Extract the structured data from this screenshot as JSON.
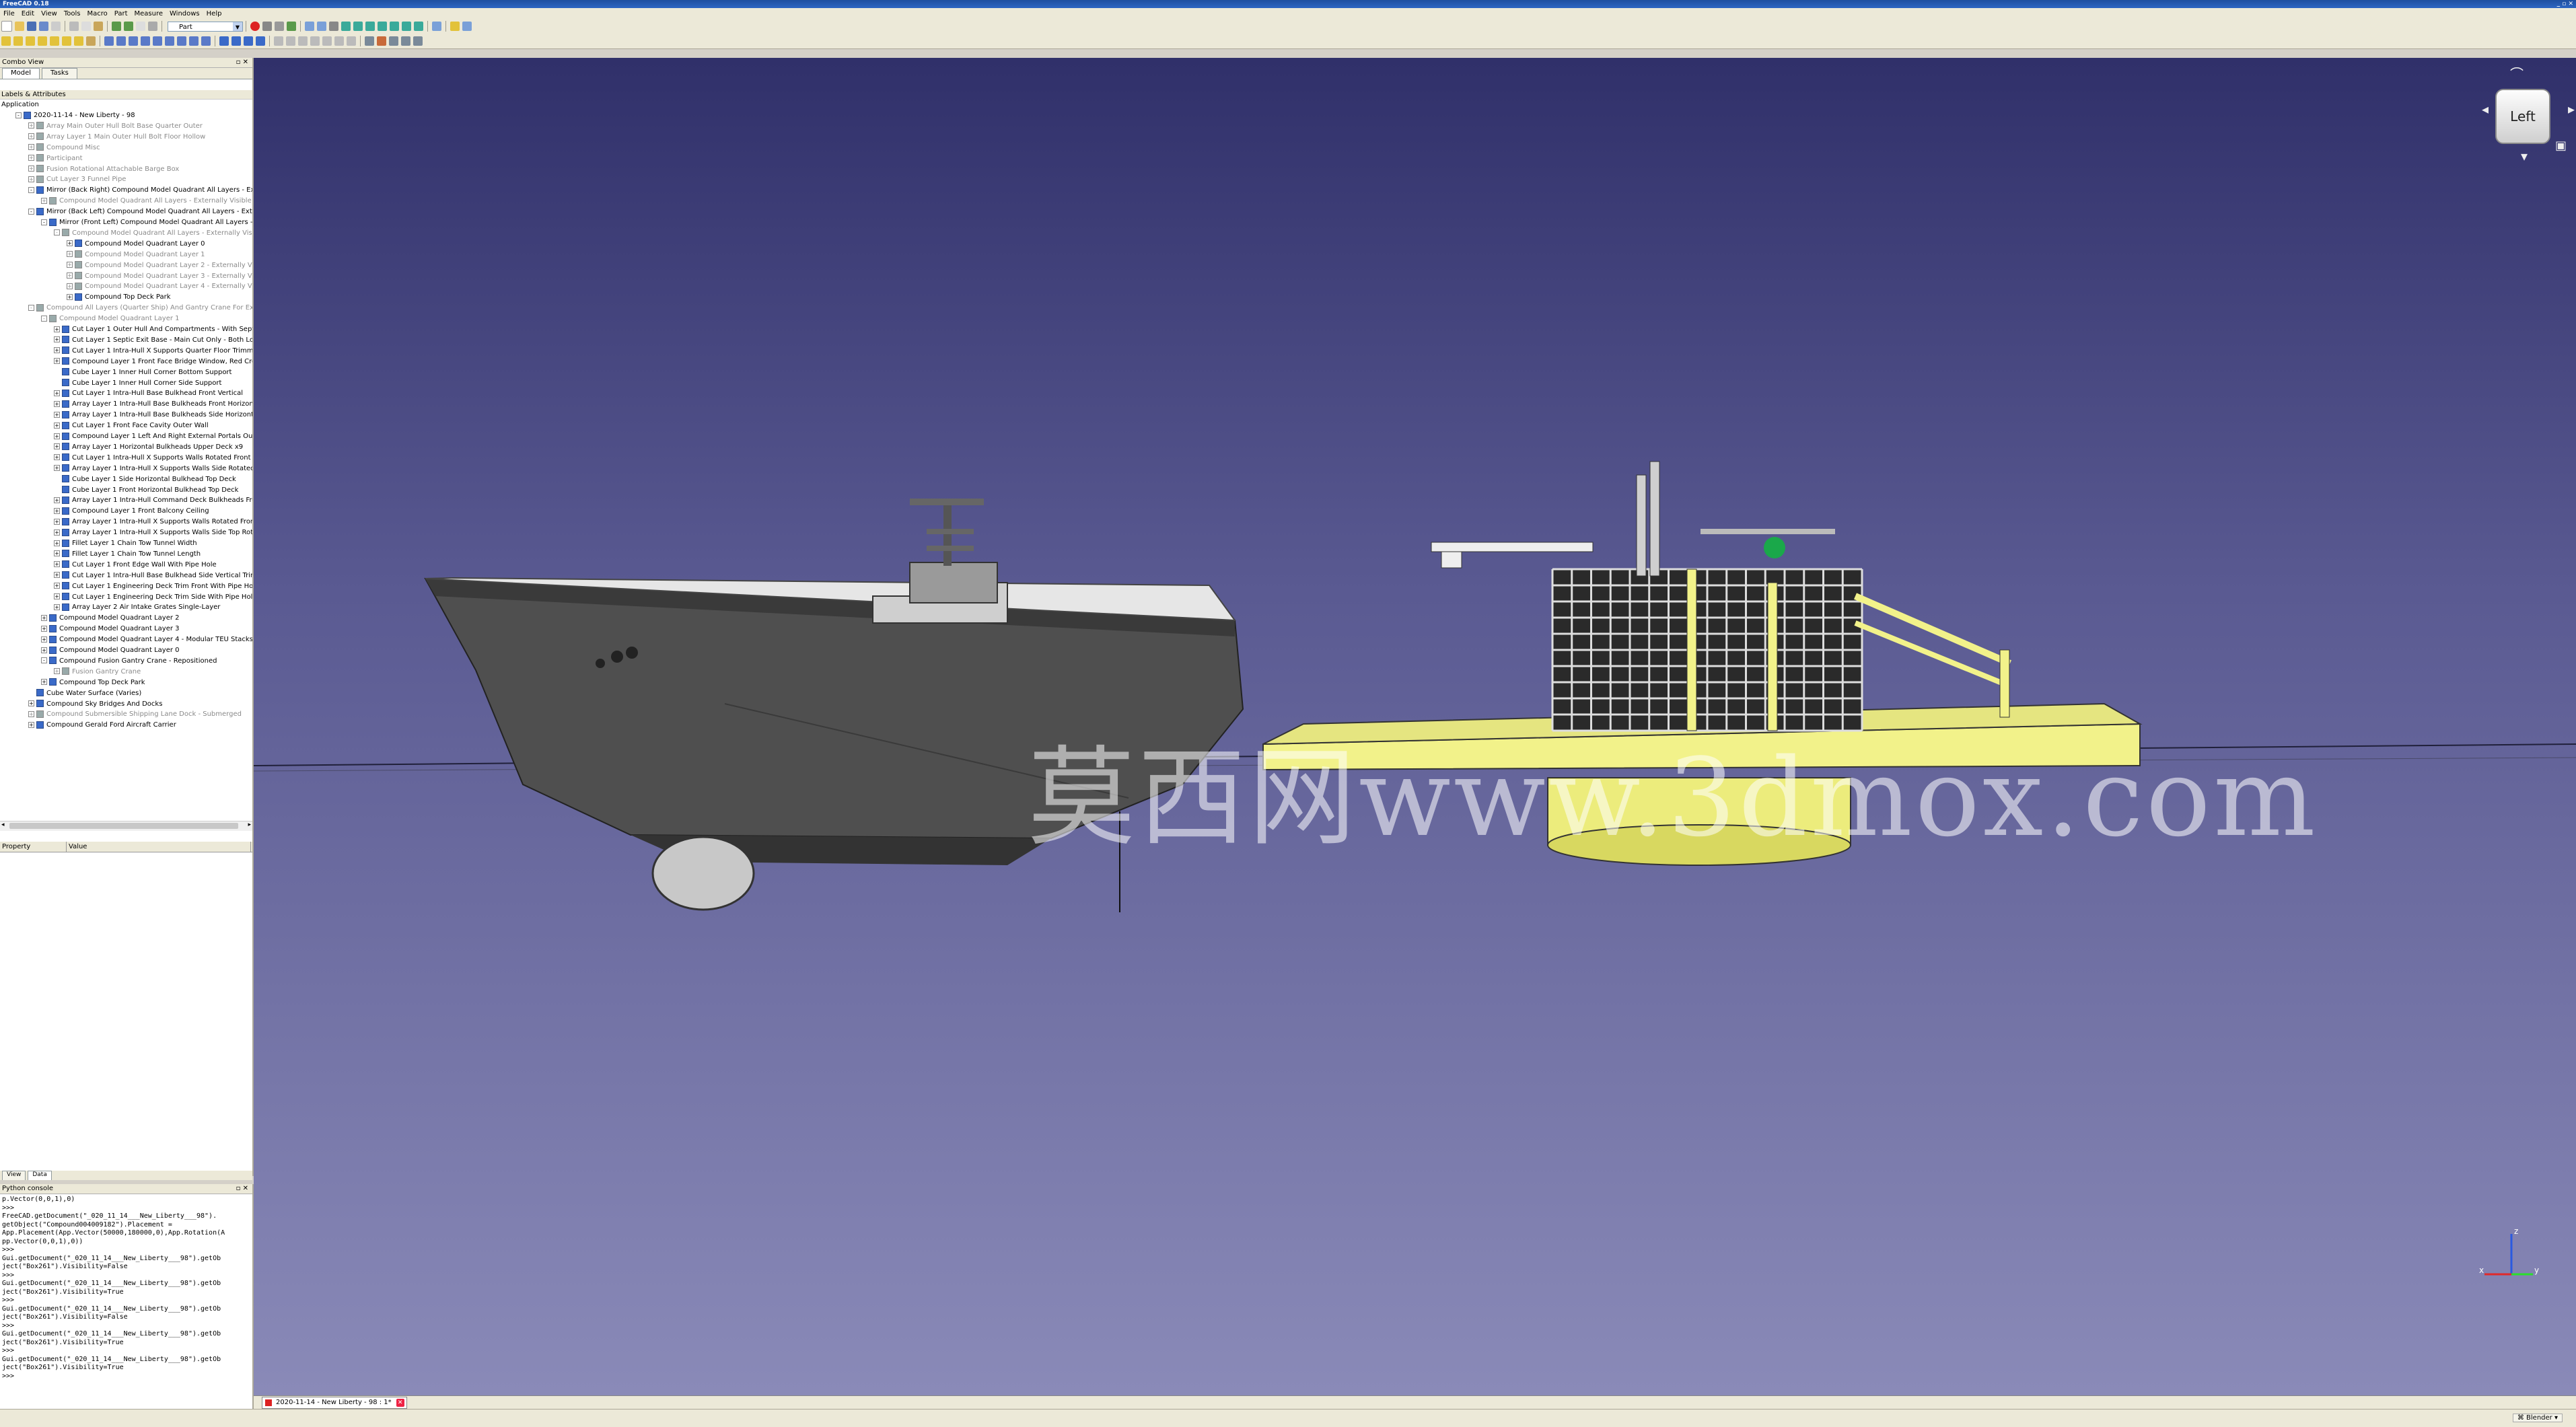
{
  "window": {
    "title": "FreeCAD 0.18",
    "controls": "_ ▫ ✕"
  },
  "menu": [
    "File",
    "Edit",
    "View",
    "Tools",
    "Macro",
    "Part",
    "Measure",
    "Windows",
    "Help"
  ],
  "toolbar": {
    "workbench": "Part"
  },
  "combo": {
    "title": "Combo View",
    "tabs": [
      "Model",
      "Tasks"
    ],
    "labels_header": "Labels & Attributes",
    "application": "Application",
    "tree": [
      {
        "text": "2020-11-14 - New Liberty - 98",
        "indent": 1,
        "grey": false,
        "exp": "-"
      },
      {
        "text": "Array Main Outer Hull Bolt Base Quarter Outer",
        "indent": 2,
        "grey": true,
        "exp": "+"
      },
      {
        "text": "Array Layer 1 Main Outer Hull Bolt Floor Hollow",
        "indent": 2,
        "grey": true,
        "exp": "+"
      },
      {
        "text": "Compound Misc",
        "indent": 2,
        "grey": true,
        "exp": "+"
      },
      {
        "text": "Participant",
        "indent": 2,
        "grey": true,
        "exp": "+"
      },
      {
        "text": "Fusion Rotational Attachable Barge Box",
        "indent": 2,
        "grey": true,
        "exp": "+"
      },
      {
        "text": "Cut Layer 3 Funnel Pipe",
        "indent": 2,
        "grey": true,
        "exp": "+"
      },
      {
        "text": "Mirror (Back Right) Compound Model Quadrant All Layers - Exter",
        "indent": 2,
        "grey": false,
        "exp": "-"
      },
      {
        "text": "Compound Model Quadrant All Layers - Externally Visible On",
        "indent": 3,
        "grey": true,
        "exp": "+"
      },
      {
        "text": "Mirror (Back Left) Compound Model Quadrant All Layers - Extern",
        "indent": 2,
        "grey": false,
        "exp": "-"
      },
      {
        "text": "Mirror (Front Left) Compound Model Quadrant All Layers - E",
        "indent": 3,
        "grey": false,
        "exp": "-"
      },
      {
        "text": "Compound Model Quadrant All Layers - Externally Visible",
        "indent": 4,
        "grey": true,
        "exp": "-"
      },
      {
        "text": "Compound Model Quadrant Layer 0",
        "indent": 5,
        "grey": false,
        "exp": "+"
      },
      {
        "text": "Compound Model Quadrant Layer 1",
        "indent": 5,
        "grey": true,
        "exp": "+"
      },
      {
        "text": "Compound Model Quadrant Layer 2 - Externally Vis",
        "indent": 5,
        "grey": true,
        "exp": "+"
      },
      {
        "text": "Compound Model Quadrant Layer 3 - Externally Vis",
        "indent": 5,
        "grey": true,
        "exp": "+"
      },
      {
        "text": "Compound Model Quadrant Layer 4 - Externally Vis",
        "indent": 5,
        "grey": true,
        "exp": "+"
      },
      {
        "text": "Compound Top Deck Park",
        "indent": 5,
        "grey": false,
        "exp": "+"
      },
      {
        "text": "Compound All Layers (Quarter Ship) And Gantry Crane For Expo",
        "indent": 2,
        "grey": true,
        "exp": "-"
      },
      {
        "text": "Compound Model Quadrant Layer 1",
        "indent": 3,
        "grey": true,
        "exp": "-"
      },
      {
        "text": "Cut Layer 1 Outer Hull And Compartments - With Septic",
        "indent": 4,
        "grey": false,
        "exp": "+"
      },
      {
        "text": "Cut Layer 1 Septic Exit Base - Main Cut Only - Both Loca",
        "indent": 4,
        "grey": false,
        "exp": "+"
      },
      {
        "text": "Cut Layer 1 Intra-Hull X Supports Quarter Floor Trimmed",
        "indent": 4,
        "grey": false,
        "exp": "+"
      },
      {
        "text": "Compound Layer 1 Front Face Bridge Window, Red Cros",
        "indent": 4,
        "grey": false,
        "exp": "+"
      },
      {
        "text": "Cube Layer 1 Inner Hull Corner Bottom Support",
        "indent": 4,
        "grey": false,
        "exp": ""
      },
      {
        "text": "Cube Layer 1 Inner Hull Corner Side Support",
        "indent": 4,
        "grey": false,
        "exp": ""
      },
      {
        "text": "Cut Layer 1 Intra-Hull Base Bulkhead Front Vertical",
        "indent": 4,
        "grey": false,
        "exp": "+"
      },
      {
        "text": "Array Layer 1 Intra-Hull Base Bulkheads Front Horizonta",
        "indent": 4,
        "grey": false,
        "exp": "+"
      },
      {
        "text": "Array Layer 1 Intra-Hull Base Bulkheads Side Horizontal",
        "indent": 4,
        "grey": false,
        "exp": "+"
      },
      {
        "text": "Cut Layer 1 Front Face Cavity Outer Wall",
        "indent": 4,
        "grey": false,
        "exp": "+"
      },
      {
        "text": "Compound Layer 1 Left And Right External Portals Oute",
        "indent": 4,
        "grey": false,
        "exp": "+"
      },
      {
        "text": "Array Layer 1 Horizontal Bulkheads Upper Deck x9",
        "indent": 4,
        "grey": false,
        "exp": "+"
      },
      {
        "text": "Cut Layer 1 Intra-Hull X Supports Walls Rotated Front T",
        "indent": 4,
        "grey": false,
        "exp": "+"
      },
      {
        "text": "Array Layer 1 Intra-Hull X Supports Walls Side Rotated I",
        "indent": 4,
        "grey": false,
        "exp": "+"
      },
      {
        "text": "Cube Layer 1 Side Horizontal Bulkhead Top Deck",
        "indent": 4,
        "grey": false,
        "exp": ""
      },
      {
        "text": "Cube Layer 1 Front Horizontal Bulkhead Top Deck",
        "indent": 4,
        "grey": false,
        "exp": ""
      },
      {
        "text": "Array Layer 1 Intra-Hull Command Deck Bulkheads Fron",
        "indent": 4,
        "grey": false,
        "exp": "+"
      },
      {
        "text": "Compound Layer 1 Front Balcony Ceiling",
        "indent": 4,
        "grey": false,
        "exp": "+"
      },
      {
        "text": "Array Layer 1 Intra-Hull X Supports Walls Rotated Front",
        "indent": 4,
        "grey": false,
        "exp": "+"
      },
      {
        "text": "Array Layer 1 Intra-Hull X Supports Walls Side Top Rota",
        "indent": 4,
        "grey": false,
        "exp": "+"
      },
      {
        "text": "Fillet Layer 1 Chain Tow Tunnel Width",
        "indent": 4,
        "grey": false,
        "exp": "+"
      },
      {
        "text": "Fillet Layer 1 Chain Tow Tunnel Length",
        "indent": 4,
        "grey": false,
        "exp": "+"
      },
      {
        "text": "Cut Layer 1 Front Edge Wall With Pipe Hole",
        "indent": 4,
        "grey": false,
        "exp": "+"
      },
      {
        "text": "Cut Layer 1 Intra-Hull Base Bulkhead Side Vertical Trimm",
        "indent": 4,
        "grey": false,
        "exp": "+"
      },
      {
        "text": "Cut Layer 1 Engineering Deck Trim Front With Pipe Hole",
        "indent": 4,
        "grey": false,
        "exp": "+"
      },
      {
        "text": "Cut Layer 1 Engineering Deck Trim Side With Pipe Hole",
        "indent": 4,
        "grey": false,
        "exp": "+"
      },
      {
        "text": "Array Layer 2 Air Intake Grates Single-Layer",
        "indent": 4,
        "grey": false,
        "exp": "+"
      },
      {
        "text": "Compound Model Quadrant Layer 2",
        "indent": 3,
        "grey": false,
        "exp": "+"
      },
      {
        "text": "Compound Model Quadrant Layer 3",
        "indent": 3,
        "grey": false,
        "exp": "+"
      },
      {
        "text": "Compound Model Quadrant Layer 4 - Modular TEU Stacks",
        "indent": 3,
        "grey": false,
        "exp": "+"
      },
      {
        "text": "Compound Model Quadrant Layer 0",
        "indent": 3,
        "grey": false,
        "exp": "+"
      },
      {
        "text": "Compound Fusion Gantry Crane - Repositioned",
        "indent": 3,
        "grey": false,
        "exp": "-"
      },
      {
        "text": "Fusion Gantry Crane",
        "indent": 4,
        "grey": true,
        "exp": "+"
      },
      {
        "text": "Compound Top Deck Park",
        "indent": 3,
        "grey": false,
        "exp": "+"
      },
      {
        "text": "Cube Water Surface (Varies)",
        "indent": 2,
        "grey": false,
        "exp": ""
      },
      {
        "text": "Compound Sky Bridges And Docks",
        "indent": 2,
        "grey": false,
        "exp": "+"
      },
      {
        "text": "Compound Submersible Shipping Lane Dock - Submerged",
        "indent": 2,
        "grey": true,
        "exp": "+"
      },
      {
        "text": "Compound Gerald Ford Aircraft Carrier",
        "indent": 2,
        "grey": false,
        "exp": "+"
      }
    ],
    "prop_headers": [
      "Property",
      "Value"
    ],
    "view_tabs": [
      "View",
      "Data"
    ]
  },
  "python": {
    "title": "Python console",
    "lines": [
      "p.Vector(0,0,1),0)",
      ">>> ",
      "FreeCAD.getDocument(\"_020_11_14___New_Liberty___98\").",
      "getObject(\"Compound004009182\").Placement =",
      "App.Placement(App.Vector(50000,180000,0),App.Rotation(A",
      "pp.Vector(0,0,1),0))",
      ">>> ",
      "Gui.getDocument(\"_020_11_14___New_Liberty___98\").getOb",
      "ject(\"Box261\").Visibility=False",
      ">>> ",
      "Gui.getDocument(\"_020_11_14___New_Liberty___98\").getOb",
      "ject(\"Box261\").Visibility=True",
      ">>> ",
      "Gui.getDocument(\"_020_11_14___New_Liberty___98\").getOb",
      "ject(\"Box261\").Visibility=False",
      ">>> ",
      "Gui.getDocument(\"_020_11_14___New_Liberty___98\").getOb",
      "ject(\"Box261\").Visibility=True",
      ">>> ",
      "Gui.getDocument(\"_020_11_14___New_Liberty___98\").getOb",
      "ject(\"Box261\").Visibility=True",
      ">>> "
    ]
  },
  "viewport": {
    "navcube_face": "Left",
    "watermark": "莫西网www.3dmox.com",
    "axis_labels": [
      "z",
      "x",
      "y"
    ]
  },
  "doc_tab": {
    "label": "2020-11-14 - New Liberty - 98 : 1*"
  },
  "status": {
    "nav_style": "Blender"
  },
  "colors": {
    "viewport_top": "#30306a",
    "viewport_bottom": "#8a8ab8",
    "platform": "#f2f28a",
    "ship": "#5a5a5a"
  }
}
